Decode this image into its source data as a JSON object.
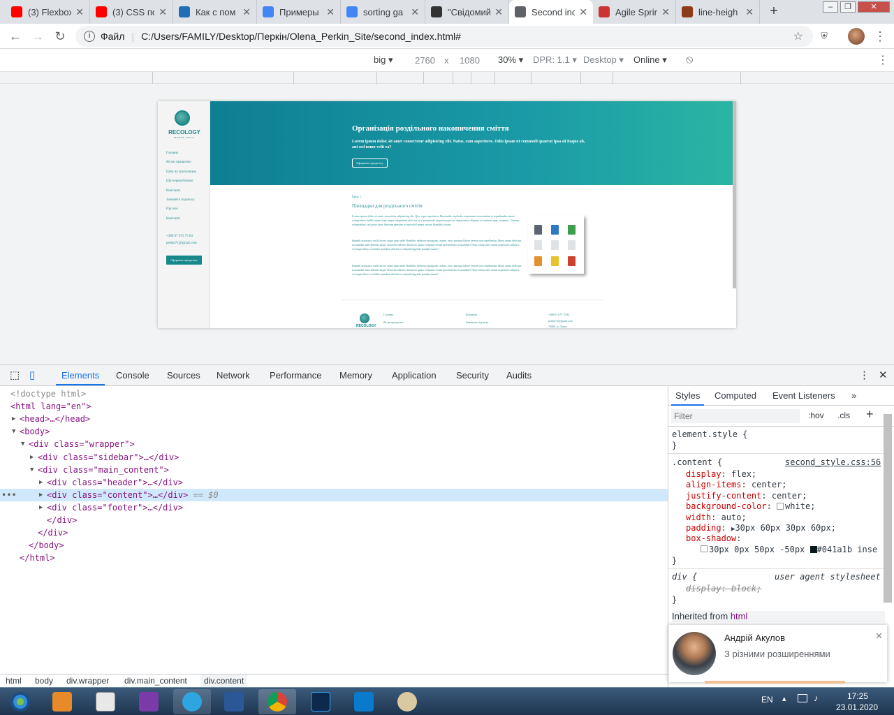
{
  "tabs": [
    {
      "title": "(3) Flexbox",
      "icon": "youtube-icon",
      "color": "#ff0000"
    },
    {
      "title": "(3) CSS по",
      "icon": "youtube-icon",
      "color": "#ff0000"
    },
    {
      "title": "Как с пом",
      "icon": "page-icon",
      "color": "#1f6fb5"
    },
    {
      "title": "Примеры",
      "icon": "google-icon",
      "color": "#4285f4"
    },
    {
      "title": "sorting ga",
      "icon": "google-icon",
      "color": "#4285f4"
    },
    {
      "title": "\"Свідомий",
      "icon": "doc-icon",
      "color": "#333333"
    },
    {
      "title": "Second inc",
      "icon": "globe-icon",
      "color": "#5f6368"
    },
    {
      "title": "Agile Sprir",
      "icon": "agile-icon",
      "color": "#cc3333"
    },
    {
      "title": "line-heigh",
      "icon": "w3-icon",
      "color": "#8b3a1a"
    }
  ],
  "address": {
    "label": "Файл",
    "url": "C:/Users/FAMILY/Desktop/Перкін/Olena_Perkin_Site/second_index.html#"
  },
  "device_toolbar": {
    "device": "big",
    "width": "2760",
    "times": "x",
    "height": "1080",
    "zoom": "30%",
    "dpr": "DPR: 1.1",
    "mode": "Desktop",
    "network": "Online"
  },
  "site": {
    "logo": "RECOLOGY",
    "logo_sub": "waste zero",
    "sidebar_items": [
      "Головна",
      "Як ми працюємо",
      "Ціни на пропозицію",
      "Що переробляємо",
      "Контакти",
      "Замовити підписку",
      "Про нас",
      "Контакти"
    ],
    "phone": "+380 67 675 75 84",
    "email": "perkin71@gmail.com",
    "order_btn": "Оформити передплату",
    "header_title": "Організація роздільного накопичення сміття",
    "header_text": "Lorem ipsum dolor, sit amet consectetur adipisicing elit. Natus, cum asperiores. Odio ipsam ut commodi quaerat ipsa sit itaque ab, aut sed nemo velit ea?",
    "header_btn": "Оформити передплату",
    "kicker": "Крок 1",
    "content_title": "Площадки для роздільного сміття",
    "paragraphs": [
      "Lorem ipsum dolor sit amet consectetur adipisicing elit. Quo, eque asperiores. Reiciendis explicabo aspernatur accusantium et repudiandae animi voluptatibus mollit minus fugit neque voluptatem delectus ut a assumenda aliquid neque cin, dignissimos aliquam accusamus quas excepturi. Veniam voluptatibus, aut porro quas laborum aperiam at sunt nihil neque, minus blanditiis totam.",
      "Impedit nostrum a nulla facere atque quas unde blanditiis delenore quisquam, autem, error aureque labore tenetur non repellendus libero animi delectus recusandae nam deleniti atque. Dolorem delenis distinctio quam voluptate rerum praesentium recusandae? Nam soluta odio omnis asperiores adipisci, vel atque laboris mollitia mundum deleniti et aliquid eligendi, pandae earum?",
      "Impedit nostrum a nulla facere atque quas unde blanditiis delenore quisquam, autem, error aureque labore tenetur non repellendus libero animi delectus recusandae nam deleniti atque. Dolorem delenis distinctio quam voluptate rerum praesentium recusandae? Nam soluta odio omnis asperiores adipisci, vel atque laboris mollitia mundum deleniti et aliquid eligendi, pandae earum?"
    ],
    "footer_col1": [
      "Головна",
      "Як ми працюємо"
    ],
    "footer_col2": [
      "Контакти",
      "Замовити підписку"
    ],
    "footer_col3": [
      "+380 67 675 75 84",
      "perkin71@gmail.com",
      "79000, м. Львів"
    ]
  },
  "devtools": {
    "tabs": [
      "Elements",
      "Console",
      "Sources",
      "Network",
      "Performance",
      "Memory",
      "Application",
      "Security",
      "Audits"
    ],
    "dom_lines": [
      {
        "text": "<!doctype html>",
        "kind": "comment",
        "indent": 0
      },
      {
        "text": "<html lang=\"en\">",
        "kind": "tag",
        "indent": 0
      },
      {
        "text": "<head>…</head>",
        "kind": "tag",
        "indent": 1,
        "tri": "right"
      },
      {
        "text": "<body>",
        "kind": "tag",
        "indent": 1,
        "tri": "down"
      },
      {
        "text": "<div class=\"wrapper\">",
        "kind": "tag",
        "indent": 2,
        "tri": "down"
      },
      {
        "text": "<div class=\"sidebar\">…</div>",
        "kind": "tag",
        "indent": 3,
        "tri": "right"
      },
      {
        "text": "<div class=\"main_content\">",
        "kind": "tag",
        "indent": 3,
        "tri": "down"
      },
      {
        "text": "<div class=\"header\">…</div>",
        "kind": "tag",
        "indent": 4,
        "tri": "right"
      },
      {
        "text": "<div class=\"content\">…</div>",
        "kind": "tag",
        "indent": 4,
        "tri": "right",
        "selected": true,
        "suffix": " == $0"
      },
      {
        "text": "<div class=\"footer\">…</div>",
        "kind": "tag",
        "indent": 4,
        "tri": "right"
      },
      {
        "text": "</div>",
        "kind": "tag",
        "indent": 4
      },
      {
        "text": "</div>",
        "kind": "tag",
        "indent": 3
      },
      {
        "text": "</body>",
        "kind": "tag",
        "indent": 2
      },
      {
        "text": "</html>",
        "kind": "tag",
        "indent": 1
      }
    ],
    "breadcrumbs": [
      "html",
      "body",
      "div.wrapper",
      "div.main_content",
      "div.content"
    ],
    "styles_tabs": [
      "Styles",
      "Computed",
      "Event Listeners",
      "»"
    ],
    "filter_placeholder": "Filter",
    "hov": ":hov",
    "cls": ".cls",
    "element_style": "element.style {",
    "close_brace": "}",
    "rule_selector": ".content {",
    "rule_source": "second_style.css:56",
    "declarations": [
      {
        "name": "display",
        "value": "flex;"
      },
      {
        "name": "align-items",
        "value": "center;"
      },
      {
        "name": "justify-content",
        "value": "center;"
      },
      {
        "name": "background-color",
        "value": "white;"
      },
      {
        "name": "width",
        "value": "auto;"
      },
      {
        "name": "padding",
        "value": "30px 60px 30px 60px;"
      },
      {
        "name": "box-shadow",
        "value": ""
      }
    ],
    "box_shadow_value": "30px 0px 50px -50px",
    "box_shadow_color": "#041a1b inse",
    "ua_selector": "div {",
    "ua_source": "user agent stylesheet",
    "ua_decl": "display: block;",
    "inherited": "Inherited from",
    "inherited_tag": "html"
  },
  "notification": {
    "name": "Андрій Акулов",
    "text": "З різними розширеннями"
  },
  "taskbar": {
    "lang": "EN",
    "time": "17:25",
    "date": "23.01.2020"
  },
  "colors": {
    "accent": "#1a73e8",
    "teal": "#17888b",
    "selection": "#cfe8fc"
  }
}
